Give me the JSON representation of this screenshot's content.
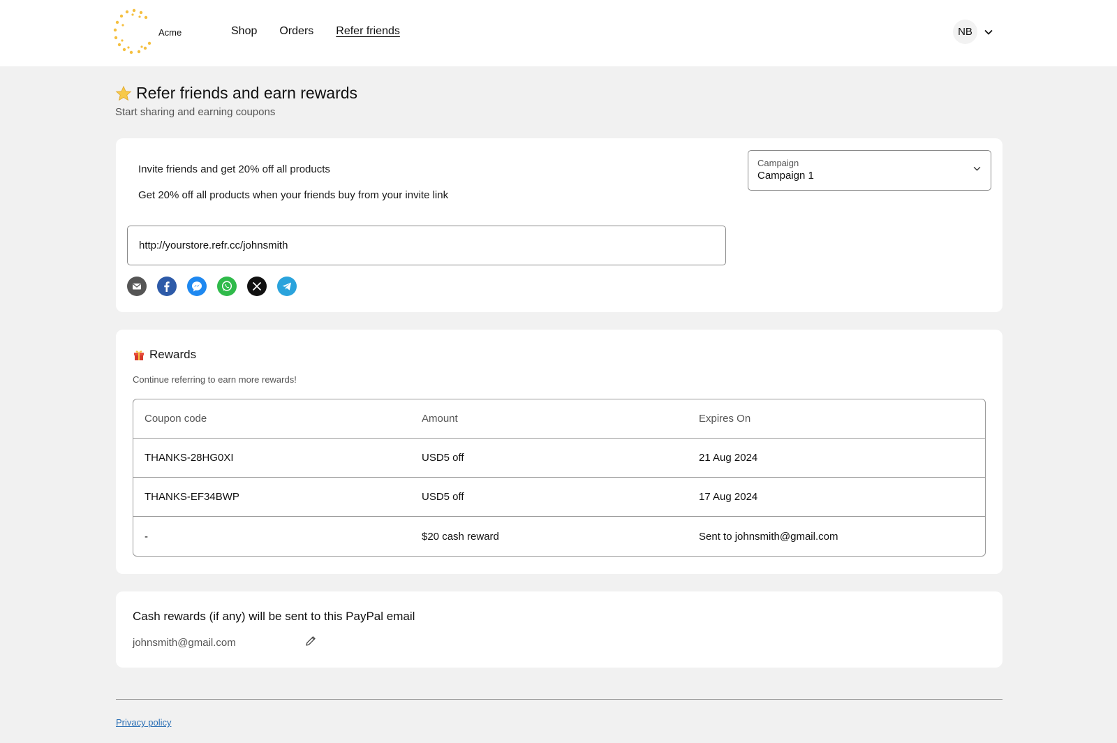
{
  "brand": {
    "name": "Acme",
    "logo_color": "#f5c040"
  },
  "nav": {
    "items": [
      {
        "label": "Shop"
      },
      {
        "label": "Orders"
      },
      {
        "label": "Refer friends"
      }
    ]
  },
  "account": {
    "initials": "NB"
  },
  "page": {
    "title": "Refer friends and earn rewards",
    "subtitle": "Start sharing and earning coupons"
  },
  "invite": {
    "title": "Invite friends and get 20% off all products",
    "description": "Get 20% off all products when your friends buy from your invite link",
    "link": "http://yourstore.refr.cc/johnsmith",
    "campaign_label": "Campaign",
    "campaign_value": "Campaign 1",
    "share_icons": [
      "email-icon",
      "facebook-icon",
      "messenger-icon",
      "whatsapp-icon",
      "x-icon",
      "telegram-icon"
    ]
  },
  "rewards": {
    "title": "Rewards",
    "subtitle": "Continue referring to earn more rewards!",
    "columns": [
      "Coupon code",
      "Amount",
      "Expires On"
    ],
    "rows": [
      [
        "THANKS-28HG0XI",
        "USD5 off",
        "21 Aug 2024"
      ],
      [
        "THANKS-EF34BWP",
        "USD5 off",
        "17 Aug 2024"
      ],
      [
        "-",
        "$20 cash reward",
        "Sent to johnsmith@gmail.com"
      ]
    ]
  },
  "paypal": {
    "title": "Cash rewards (if any) will be sent to this PayPal email",
    "email": "johnsmith@gmail.com"
  },
  "footer": {
    "privacy_label": "Privacy policy"
  },
  "colors": {
    "accent_link": "#2a6fb5",
    "facebook": "#2d5aa8",
    "messenger": "#1e88f0",
    "whatsapp": "#2fba4a",
    "telegram": "#2aa3dc"
  }
}
